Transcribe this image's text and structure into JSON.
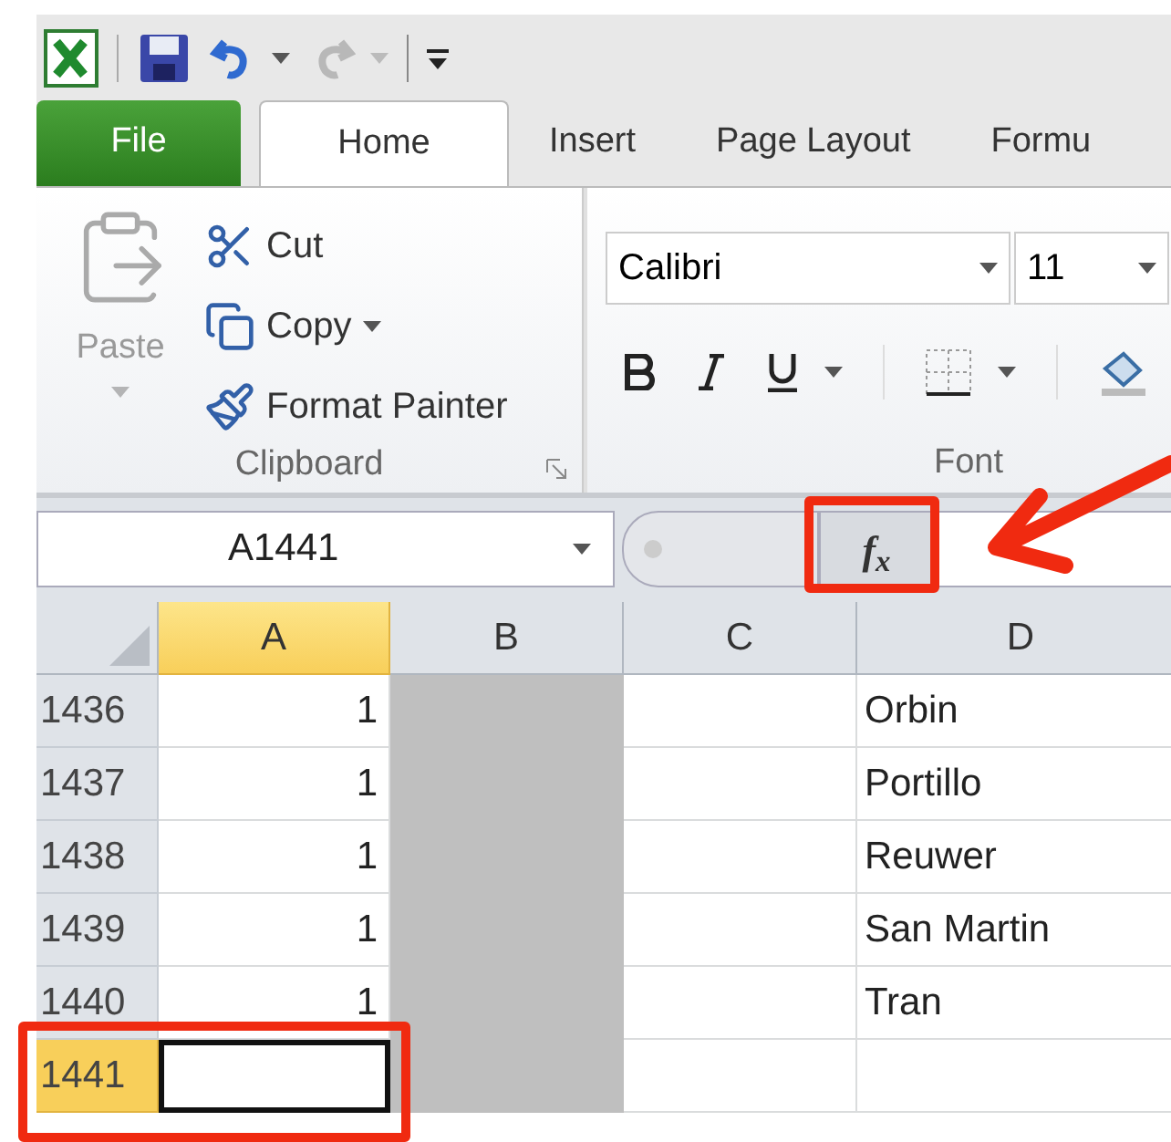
{
  "quick_access": [
    {
      "kind": "save",
      "disabled": false
    },
    {
      "kind": "undo",
      "disabled": false
    },
    {
      "kind": "redo",
      "disabled": true
    }
  ],
  "tabs": [
    {
      "label": "File",
      "kind": "file",
      "selected": false
    },
    {
      "label": "Home",
      "kind": "tab",
      "selected": true
    },
    {
      "label": "Insert",
      "kind": "tab",
      "selected": false
    },
    {
      "label": "Page Layout",
      "kind": "tab",
      "selected": false
    },
    {
      "label": "Formu",
      "kind": "tab",
      "selected": false
    }
  ],
  "clipboard": {
    "paste": {
      "label": "Paste",
      "disabled": true
    },
    "items": [
      {
        "kind": "cut",
        "label": "Cut",
        "dropdown": false
      },
      {
        "kind": "copy",
        "label": "Copy",
        "dropdown": true
      },
      {
        "kind": "painter",
        "label": "Format Painter",
        "dropdown": false
      }
    ],
    "group_label": "Clipboard"
  },
  "font": {
    "name": "Calibri",
    "size": "11",
    "group_label": "Font"
  },
  "formula_bar": {
    "name_box": "A1441",
    "fx": "f$_{x}$"
  },
  "grid": {
    "columns": [
      {
        "label": "A",
        "selected": true,
        "shaded": false
      },
      {
        "label": "B",
        "selected": false,
        "shaded": true
      },
      {
        "label": "C",
        "selected": false,
        "shaded": false
      },
      {
        "label": "D",
        "selected": false,
        "shaded": false
      }
    ],
    "rows": [
      {
        "header": "1436",
        "selected": false,
        "a": "1",
        "d": "Orbin"
      },
      {
        "header": "1437",
        "selected": false,
        "a": "1",
        "d": "Portillo"
      },
      {
        "header": "1438",
        "selected": false,
        "a": "1",
        "d": "Reuwer"
      },
      {
        "header": "1439",
        "selected": false,
        "a": "1",
        "d": "San Martin"
      },
      {
        "header": "1440",
        "selected": false,
        "a": "1",
        "d": "Tran"
      },
      {
        "header": "1441",
        "selected": true,
        "active": true
      }
    ]
  }
}
